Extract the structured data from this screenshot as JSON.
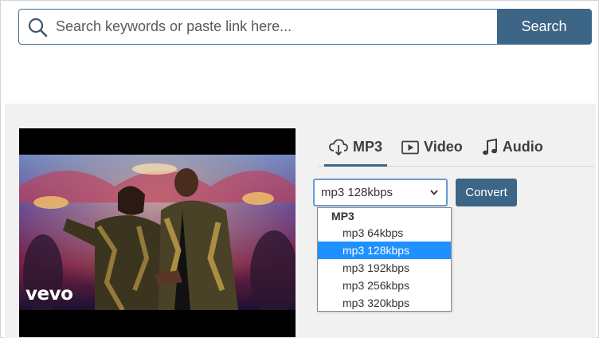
{
  "search": {
    "placeholder": "Search keywords or paste link here...",
    "button_label": "Search",
    "icon": "search-icon"
  },
  "video": {
    "logo_text": "vevo"
  },
  "tabs": [
    {
      "label": "MP3",
      "icon": "download-cloud-icon",
      "active": true
    },
    {
      "label": "Video",
      "icon": "play-video-icon",
      "active": false
    },
    {
      "label": "Audio",
      "icon": "music-note-icon",
      "active": false
    }
  ],
  "format_select": {
    "selected": "mp3 128kbps"
  },
  "convert_label": "Convert",
  "dropdown": {
    "group": "MP3",
    "options": [
      {
        "label": "mp3 64kbps"
      },
      {
        "label": "mp3 128kbps",
        "selected": true
      },
      {
        "label": "mp3 192kbps"
      },
      {
        "label": "mp3 256kbps"
      },
      {
        "label": "mp3 320kbps"
      }
    ]
  },
  "colors": {
    "accent": "#3d6586",
    "highlight": "#1e90ff",
    "panel_bg": "#f1f1f1"
  }
}
